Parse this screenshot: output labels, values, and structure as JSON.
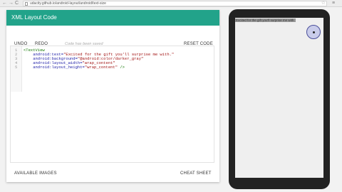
{
  "browser": {
    "back_icon": "←",
    "forward_icon": "→",
    "reload_icon": "C",
    "url": "udacity.github.io/android-layout/android/text-size",
    "star_icon": "☆",
    "menu_icon": "≡"
  },
  "editor": {
    "title": "XML Layout Code",
    "undo_label": "UNDO",
    "redo_label": "REDO",
    "saved_text": "Code has been saved",
    "reset_label": "RESET CODE",
    "line_numbers": [
      "1",
      "2",
      "3",
      "4",
      "5"
    ],
    "code": {
      "line1_tag": "<TextView",
      "line2_attr": "    android:text=",
      "line2_val": "\"Excited for the gift you'll surprise me with.\"",
      "line3_attr": "    android:background=",
      "line3_val": "\"@android:color/darker_gray\"",
      "line4_attr": "    android:layout_width=",
      "line4_val": "\"wrap_content\"",
      "line5_attr": "    android:layout_height=",
      "line5_val": "\"wrap_content\"",
      "line5_end": " />"
    },
    "available_images_label": "AVAILABLE IMAGES",
    "cheat_sheet_label": "CHEAT SHEET",
    "header_color": "#22a38a"
  },
  "phone": {
    "preview_text": "Excited for the gift you'll surprise me with."
  }
}
